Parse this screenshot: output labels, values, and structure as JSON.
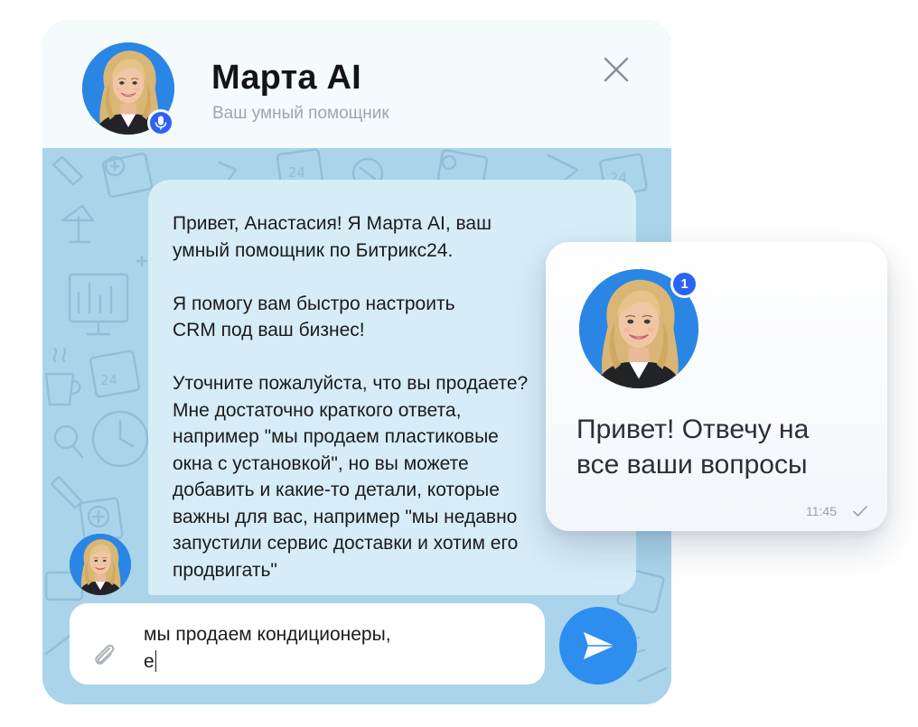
{
  "header": {
    "title": "Марта AI",
    "subtitle": "Ваш умный помощник"
  },
  "bot_message": {
    "text": "Привет, Анастасия! Я Марта AI, ваш\nумный помощник по Битрикс24.\n\nЯ помогу вам быстро настроить\nCRM под ваш бизнес!\n\nУточните пожалуйста, что вы продаете?\nМне достаточно краткого ответа,\nнапример \"мы продаем пластиковые\nокна с установкой\", но вы можете\nдобавить и какие-то детали, которые\nважны для вас, например \"мы недавно\nзапустили сервис доставки и хотим его\nпродвигать\""
  },
  "input": {
    "value": "мы продаем кондиционеры,\nе"
  },
  "notification": {
    "badge_count": "1",
    "text": "Привет! Отвечу на\nвсе ваши вопросы",
    "time": "11:45"
  },
  "icons": {
    "mic": "microphone-icon",
    "close": "close-icon",
    "attach": "paperclip-icon",
    "send": "send-icon",
    "read": "check-icon"
  },
  "colors": {
    "accent_blue": "#2b63f5",
    "send_button": "#2d8ef0",
    "chat_background": "#a9d4ea",
    "bubble": "#d6ecf7",
    "header_background": "#f5fbfd"
  }
}
